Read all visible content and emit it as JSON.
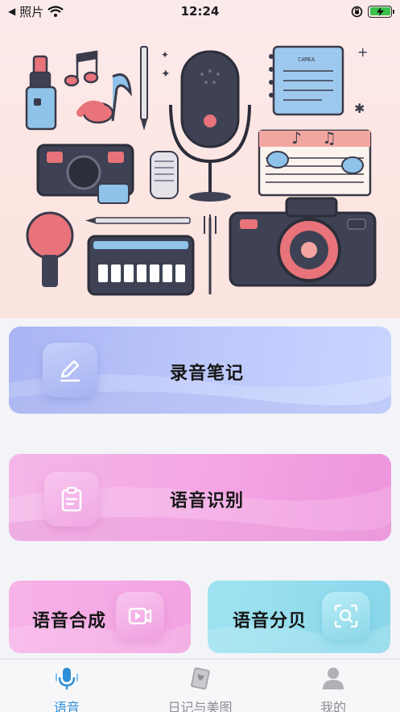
{
  "status_bar": {
    "back_label": "照片",
    "time": "12:24"
  },
  "hero": {
    "camera_note_text": "CAMEA"
  },
  "features": {
    "record_notes": "录音笔记",
    "speech_recognition": "语音识别",
    "speech_synthesis": "语音合成",
    "decibel": "语音分贝"
  },
  "tabs": [
    {
      "label": "语音",
      "icon": "microphone-icon",
      "active": true
    },
    {
      "label": "日记与美图",
      "icon": "diary-icon",
      "active": false
    },
    {
      "label": "我的",
      "icon": "user-icon",
      "active": false
    }
  ],
  "colors": {
    "accent": "#2d8fd9",
    "record_card": "#b5c0f8",
    "speech_card": "#f2a6e3",
    "synth_card": "#f4abe4",
    "decibel_card": "#93dcee",
    "battery": "#39c14a"
  }
}
